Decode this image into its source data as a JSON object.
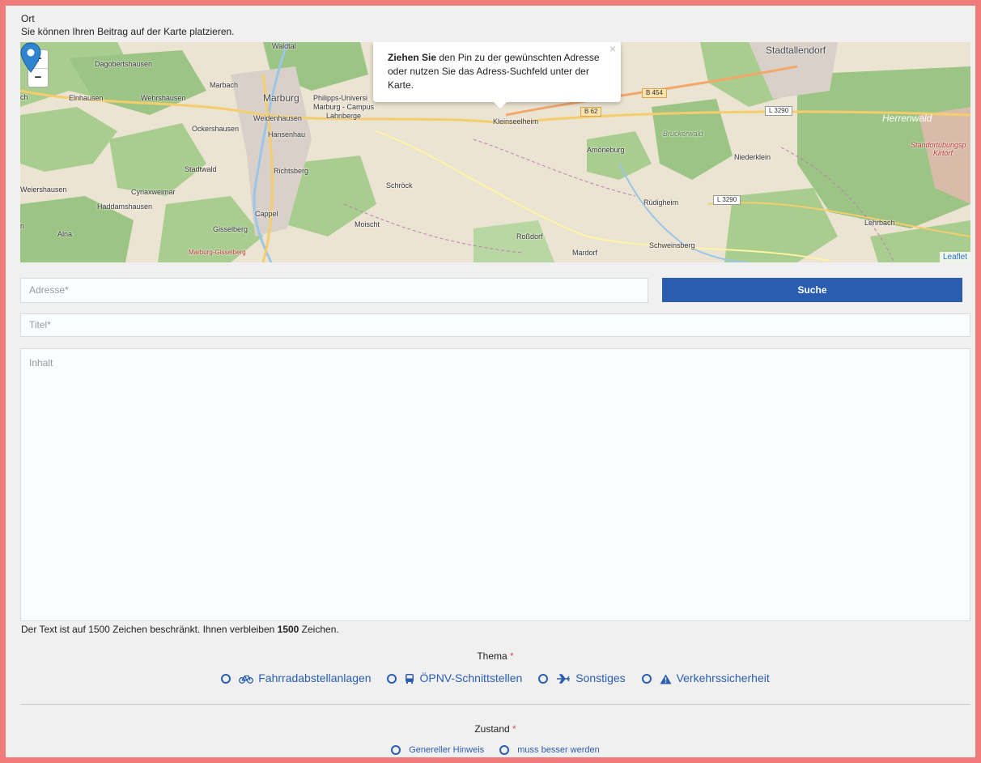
{
  "location": {
    "label": "Ort",
    "hint": "Sie können Ihren Beitrag auf der Karte platzieren."
  },
  "map": {
    "zoom_in": "+",
    "zoom_out": "−",
    "popup": {
      "bold": "Ziehen Sie",
      "rest": " den Pin zu der gewünschten Adresse oder nutzen Sie das Adress-Suchfeld unter der Karte.",
      "close": "×"
    },
    "attribution": "Leaflet",
    "places": [
      "Dagobertshausen",
      "Marbach",
      "Elnhausen",
      "Wehrshausen",
      "Marburg",
      "Philipps-Universi",
      "Marburg - Campus",
      "Lahnberge",
      "Weidenhausen",
      "Ockershausen",
      "Hansenhau",
      "Stadtwald",
      "Richtsberg",
      "Weiershausen",
      "Cyriaxweimar",
      "Haddamshausen",
      "Cappel",
      "Alna",
      "Gisselberg",
      "Marburg-Gisselberg",
      "Schröck",
      "Moischt",
      "Roßdorf",
      "Mardorf",
      "Kleinseelheim",
      "Amöneburg",
      "Rüdigheim",
      "Schweinsberg",
      "Niederklein",
      "Bruckerwald",
      "Herrenwald",
      "Lehrbach",
      "Stadtallendorf",
      "Waldtal",
      "Standortübungsp",
      "Kirtorf",
      "n",
      "ch"
    ],
    "roads": [
      "B 454",
      "B 62",
      "L 3290",
      "L 3290"
    ]
  },
  "form": {
    "address_placeholder": "Adresse*",
    "search_button": "Suche",
    "title_placeholder": "Titel*",
    "content_placeholder": "Inhalt",
    "counter_prefix": "Der Text ist auf 1500 Zeichen beschränkt. Ihnen verbleiben ",
    "counter_value": "1500",
    "counter_suffix": " Zeichen."
  },
  "thema": {
    "label": "Thema",
    "required_mark": "*",
    "options": [
      {
        "label": "Fahrradabstellanlagen",
        "icon": "bicycle-icon"
      },
      {
        "label": "ÖPNV-Schnittstellen",
        "icon": "bus-icon"
      },
      {
        "label": "Sonstiges",
        "icon": "plane-icon"
      },
      {
        "label": "Verkehrssicherheit",
        "icon": "warning-icon"
      }
    ]
  },
  "zustand": {
    "label": "Zustand",
    "required_mark": "*",
    "options": [
      {
        "label": "Genereller Hinweis"
      },
      {
        "label": "muss besser werden"
      }
    ]
  },
  "colors": {
    "border": "#f07b7b",
    "accent": "#2a5db0",
    "forest": "#8fbf75",
    "background": "#f0f0f0"
  }
}
